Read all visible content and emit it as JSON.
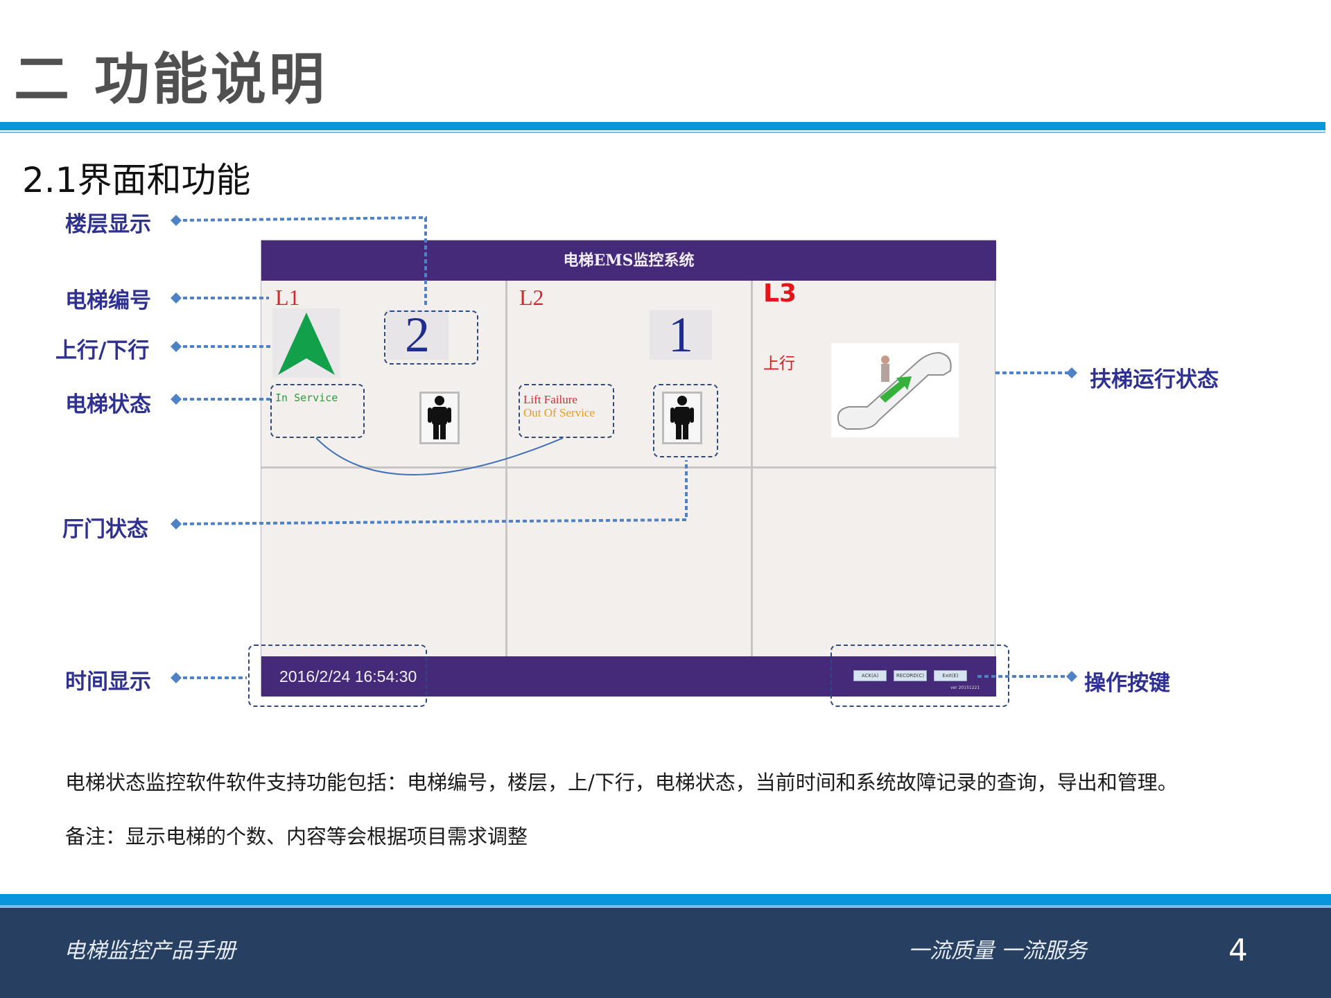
{
  "slide": {
    "title": "二 功能说明",
    "section": "2.1界面和功能",
    "page_number": "4"
  },
  "callouts": {
    "floor": "楼层显示",
    "elevator_id": "电梯编号",
    "direction": "上行/下行",
    "elevator_status": "电梯状态",
    "hall_door": "厅门状态",
    "time": "时间显示",
    "escalator": "扶梯运行状态",
    "buttons": "操作按键"
  },
  "screen": {
    "header": "电梯EMS监控系统",
    "panels": [
      {
        "label": "L1",
        "floor": "2",
        "status_line1": "In Service",
        "status_line2": "",
        "status_color": "#2e9a3a"
      },
      {
        "label": "L2",
        "floor": "1",
        "status_line1": "Lift Failure",
        "status_line2": "Out Of Service",
        "status_color": "#d6282c",
        "status2_color": "#e69a1e"
      },
      {
        "label": "L3",
        "direction": "上行"
      }
    ],
    "time": "2016/2/24 16:54:30",
    "buttons": [
      "ACK(A)",
      "RECORD(C)",
      "Exit(E)"
    ],
    "version": "ver 20151221"
  },
  "body": {
    "line1": "电梯状态监控软件软件支持功能包括：电梯编号，楼层，上/下行，电梯状态，当前时间和系统故障记录的查询，导出和管理。",
    "line2": "备注：显示电梯的个数、内容等会根据项目需求调整"
  },
  "footer": {
    "left": "电梯监控产品手册",
    "right": "一流质量 一流服务"
  },
  "colors": {
    "accent_blue": "#0797d9",
    "screen_purple": "#462a7a",
    "callout_text": "#2e3192",
    "footer_bg": "#273f61"
  }
}
